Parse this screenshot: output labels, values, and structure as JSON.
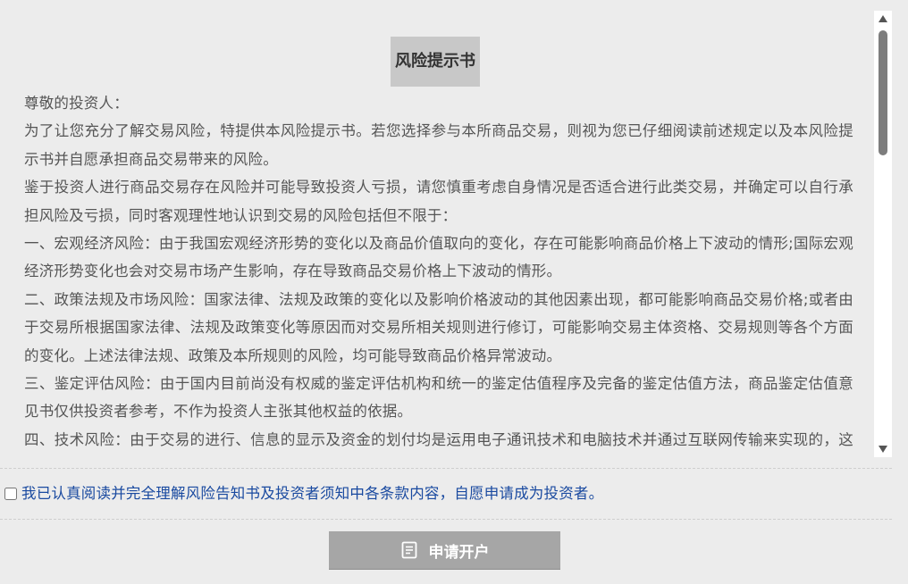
{
  "document": {
    "title": "风险提示书",
    "paragraphs": [
      "尊敬的投资人：",
      "为了让您充分了解交易风险，特提供本风险提示书。若您选择参与本所商品交易，则视为您已仔细阅读前述规定以及本风险提示书并自愿承担商品交易带来的风险。",
      "鉴于投资人进行商品交易存在风险并可能导致投资人亏损，请您慎重考虑自身情况是否适合进行此类交易，并确定可以自行承担风险及亏损，同时客观理性地认识到交易的风险包括但不限于：",
      "一、宏观经济风险：由于我国宏观经济形势的变化以及商品价值取向的变化，存在可能影响商品价格上下波动的情形;国际宏观经济形势变化也会对交易市场产生影响，存在导致商品交易价格上下波动的情形。",
      "二、政策法规及市场风险：国家法律、法规及政策的变化以及影响价格波动的其他因素出现，都可能影响商品交易价格;或者由于交易所根据国家法律、法规及政策变化等原因而对交易所相关规则进行修订，可能影响交易主体资格、交易规则等各个方面的变化。上述法律法规、政策及本所规则的风险，均可能导致商品价格异常波动。",
      "三、鉴定评估风险：由于国内目前尚没有权威的鉴定评估机构和统一的鉴定估值程序及完备的鉴定估值方法，商品鉴定估值意见书仅供投资者参考，不作为投资人主张其他权益的依据。",
      "四、技术风险：由于交易的进行、信息的显示及资金的划付均是运用电子通讯技术和电脑技术并通过互联网传输来实现的，这些技术存在被网络黑客和计算机病毒攻击的可能，由此可能给您带来损失。"
    ]
  },
  "scrollbar": {
    "up_icon": "triangle-up-icon",
    "down_icon": "triangle-down-icon"
  },
  "agreement": {
    "label": "我已认真阅读并完全理解风险告知书及投资者须知中各条款内容，自愿申请成为投资者。",
    "checked": false
  },
  "submit": {
    "label": "申请开户",
    "icon": "document-icon"
  },
  "colors": {
    "background": "#ececec",
    "title_bg": "#c8c8c8",
    "body_text": "#555555",
    "agreement_text": "#1a4aa0",
    "button_bg": "#a6a6a6"
  }
}
